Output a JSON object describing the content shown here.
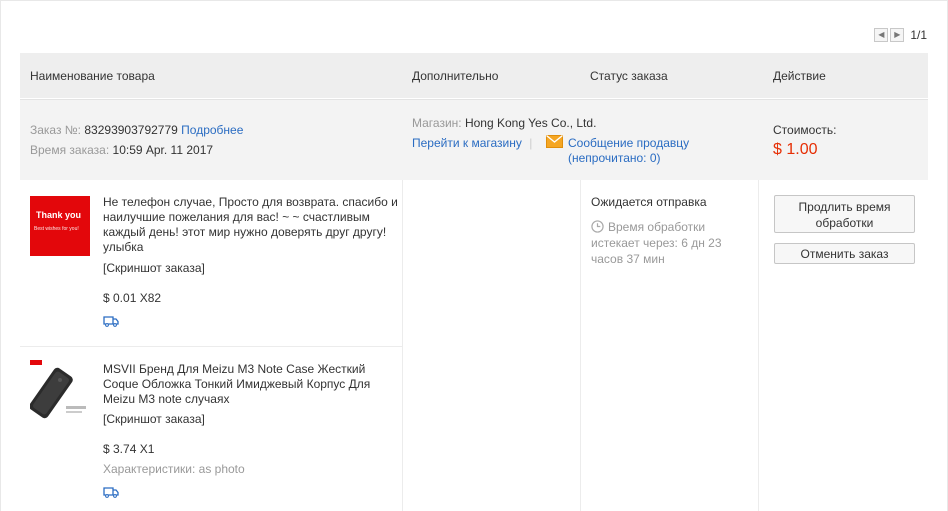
{
  "pager": {
    "prev": "◀",
    "next": "▶",
    "page": "1/1"
  },
  "header": {
    "product": "Наименование товара",
    "additional": "Дополнительно",
    "status": "Статус заказа",
    "action": "Действие"
  },
  "order": {
    "number_label": "Заказ №:",
    "number": "83293903792779",
    "details_link": "Подробнее",
    "time_label": "Время заказа:",
    "time": "10:59 Apr. 11 2017",
    "store_label": "Магазин:",
    "store_name": "Hong Kong Yes Co., Ltd.",
    "store_link": "Перейти к магазину",
    "separator": "|",
    "message_link": "Сообщение продавцу",
    "unread": "(непрочитано: 0)",
    "cost_label": "Стоимость:",
    "cost": "$ 1.00"
  },
  "products": [
    {
      "thumb_text": "Thank you",
      "thumb_subtext": "Best wishes for you!",
      "title": "Не телефон случае, Просто для возврата. спасибо и наилучшие пожелания для вас! ~ ~ счастливым каждый день! этот мир нужно доверять друг другу! улыбка",
      "snapshot": "[Скриншот заказа]",
      "price": "$ 0.01 X82"
    },
    {
      "title": "MSVII Бренд Для Meizu M3 Note Case Жесткий Coque Обложка Тонкий Имиджевый Корпус Для Meizu M3 note случаях",
      "snapshot": "[Скриншот заказа]",
      "price": "$ 3.74 X1",
      "specs": "Характеристики: as photo"
    }
  ],
  "status": {
    "text": "Ожидается отправка",
    "timer": "Время обработки истекает через: 6 дн 23 часов 37 мин"
  },
  "actions": {
    "extend": "Продлить время обработки",
    "cancel": "Отменить заказ"
  },
  "colors": {
    "link": "#2a6cc2",
    "price": "#e62e04",
    "header_bg": "#eeeeee",
    "order_bg": "#f3f3f3"
  }
}
